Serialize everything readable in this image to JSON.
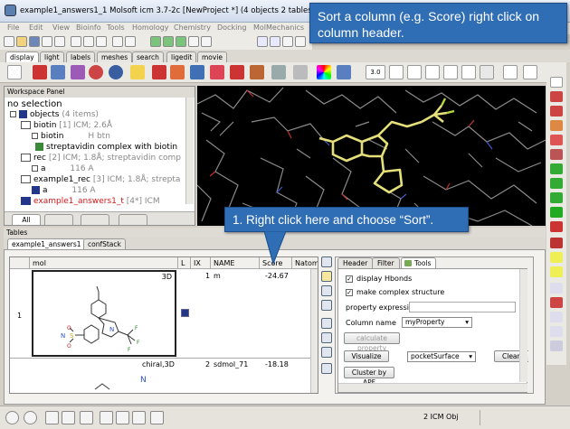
{
  "window": {
    "title": "example1_answers1_1 Molsoft icm 3.7-2c  [NewProject *] (4 objects 2 tables)"
  },
  "menu": [
    "File",
    "Edit",
    "View",
    "Bioinfo",
    "Tools",
    "Homology",
    "Chemistry",
    "Docking",
    "MolMechanics"
  ],
  "top_tabs": [
    "display",
    "light",
    "labels",
    "meshes",
    "search",
    "ligedit",
    "movie"
  ],
  "callout_top": "Sort a column (e.g. Score) right click on column header.",
  "callout_mid": "1. Right click here and choose “Sort”.",
  "workspace": {
    "title": "Workspace Panel",
    "selection": "no selection",
    "objects_label": "objects",
    "objects_count": "(4 items)",
    "items": [
      {
        "name": "biotin",
        "info": "[1] ICM; 2.6Å"
      },
      {
        "name": "biotin",
        "info": "H  btn"
      },
      {
        "name": "streptavidin complex with biotin",
        "info": ""
      },
      {
        "name": "rec",
        "info": "[2] ICM; 1.8Å; streptavidin comp"
      },
      {
        "name": "a",
        "info": "116 A"
      },
      {
        "name": "example1_rec",
        "info": "[3] ICM; 1.8Å; strepta"
      },
      {
        "name": "a",
        "info": "116 A"
      },
      {
        "name": "example1_answers1_t",
        "info": "[4*] ICM"
      }
    ],
    "bottom_tab": "All"
  },
  "tables": {
    "title": "Tables",
    "tabs": [
      "example1_answers1",
      "confStack"
    ],
    "columns": [
      "mol",
      "L",
      "IX",
      "NAME",
      "Score",
      "Natom"
    ],
    "rows": [
      {
        "row": "1",
        "tag": "3D",
        "ix": "1",
        "name": "m",
        "score": "-24.67"
      },
      {
        "row": "",
        "tag": "chiral,3D",
        "ix": "2",
        "name": "sdmol_71",
        "score": "-18.18"
      }
    ]
  },
  "tools_panel": {
    "tabs": [
      "Header",
      "Filter",
      "Tools"
    ],
    "display_hbonds": "display Hbonds",
    "make_complex": "make complex structure",
    "property_expression": "property expression",
    "column_name_label": "Column name",
    "column_name_value": "myProperty",
    "calculate_property": "calculate property",
    "visualize": "Visualize",
    "visualize_option": "pocketSurface",
    "clear": "Clear All",
    "cluster": "Cluster by APF"
  },
  "status": {
    "objects": "2 ICM Obj"
  },
  "toolbar_value": "3.0",
  "colors": {
    "callout": "#2f6db5",
    "ligand": "#e6e07a",
    "protein": "#8a8a8a",
    "background3d": "#000000",
    "highlight": "#d01818"
  }
}
